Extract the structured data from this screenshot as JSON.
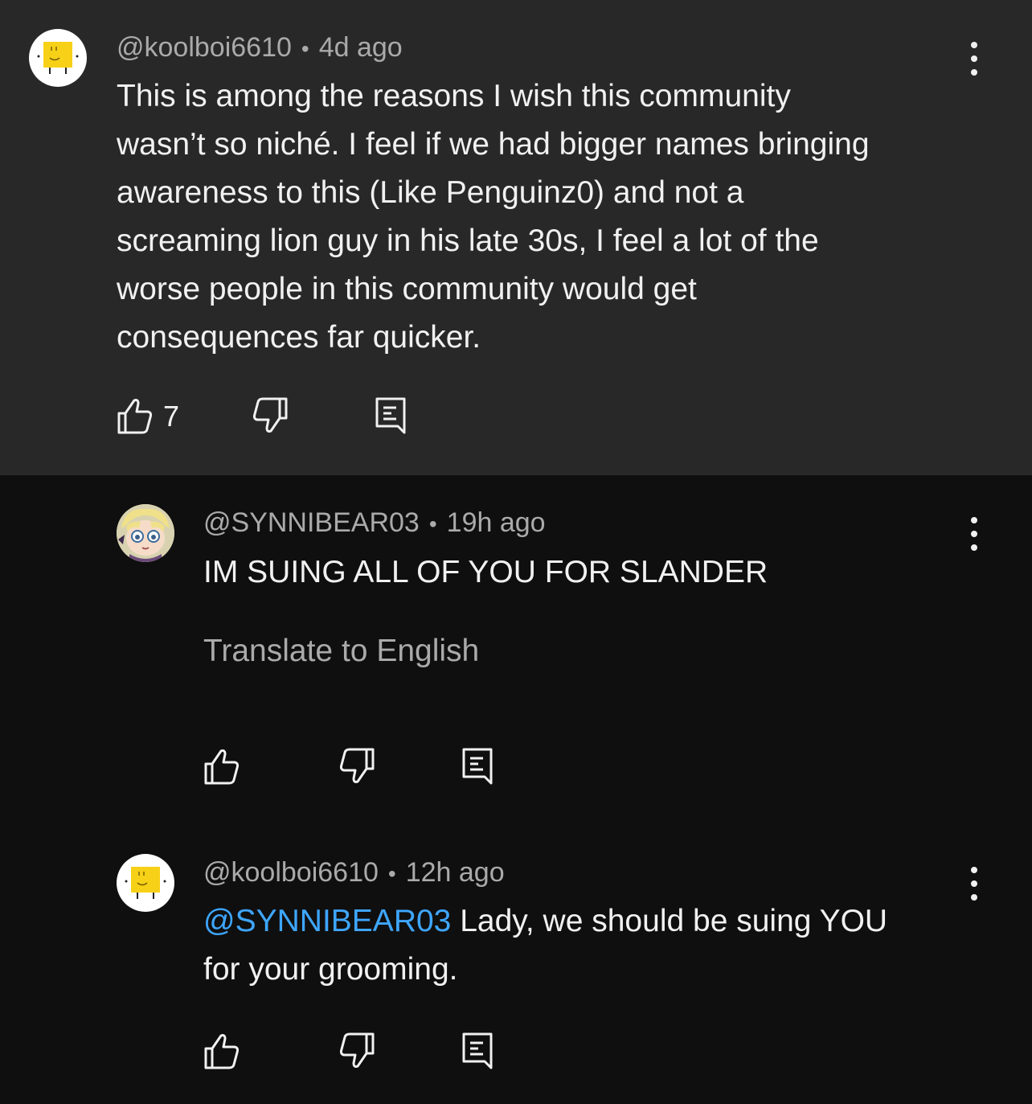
{
  "comments": [
    {
      "user": "@koolboi6610",
      "time": "4d ago",
      "separator": "•",
      "text_lines": [
        "This is among the reasons I wish this community",
        "wasn’t so niché. I feel if we had bigger names bringing",
        "awareness to this (Like Penguinz0) and not a",
        "screaming lion guy in his late 30s, I feel a lot of the",
        "worse people in this community would get",
        "consequences far quicker."
      ],
      "like_count": "7",
      "avatar": "yellow-square-face-avatar"
    },
    {
      "user": "@SYNNIBEAR03",
      "time": "19h ago",
      "separator": "•",
      "text_lines": [
        "IM SUING ALL OF YOU FOR SLANDER"
      ],
      "translate_label": "Translate to English",
      "avatar": "anime-character-avatar"
    },
    {
      "user": "@koolboi6610",
      "time": "12h ago",
      "separator": "•",
      "mention": "@SYNNIBEAR03",
      "text_line1_rest": " Lady, we should be suing YOU",
      "text_line2": "for your grooming.",
      "avatar": "yellow-square-face-avatar"
    }
  ],
  "colors": {
    "top_comment_bg": "#282828",
    "page_bg": "#0f0f0f",
    "mention": "#3ea6ff",
    "meta_text": "#aaaaaa",
    "avatar_yellow": "#f7d117"
  },
  "icons": [
    "thumbs-up-icon",
    "thumbs-down-icon",
    "reply-icon",
    "more-vert-icon"
  ]
}
